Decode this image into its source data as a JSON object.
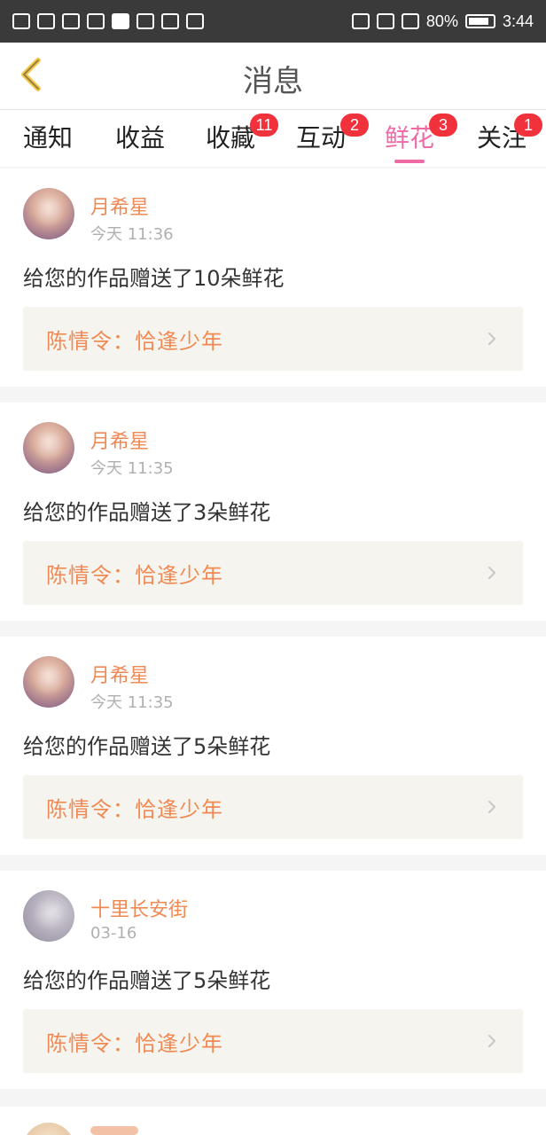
{
  "status_bar": {
    "battery_text": "80%",
    "time": "3:44"
  },
  "header": {
    "title": "消息",
    "back_icon": "chevron-left-icon"
  },
  "tabs": [
    {
      "label": "通知",
      "badge": ""
    },
    {
      "label": "收益",
      "badge": ""
    },
    {
      "label": "收藏",
      "badge": "11"
    },
    {
      "label": "互动",
      "badge": "2"
    },
    {
      "label": "鲜花",
      "badge": "3",
      "active": true
    },
    {
      "label": "关注",
      "badge": "1"
    }
  ],
  "feed": {
    "items": [
      {
        "name": "月希星",
        "time": "今天 11:36",
        "message": "给您的作品赠送了10朵鲜花",
        "work": "陈情令：恰逢少年"
      },
      {
        "name": "月希星",
        "time": "今天 11:35",
        "message": "给您的作品赠送了3朵鲜花",
        "work": "陈情令：恰逢少年"
      },
      {
        "name": "月希星",
        "time": "今天 11:35",
        "message": "给您的作品赠送了5朵鲜花",
        "work": "陈情令：恰逢少年"
      },
      {
        "name": "十里长安街",
        "time": "03-16",
        "message": "给您的作品赠送了5朵鲜花",
        "work": "陈情令：恰逢少年"
      }
    ]
  },
  "colors": {
    "accent": "#f06aa6",
    "name": "#f08a55",
    "badge": "#f1313b",
    "work_bg": "#f6f4ee"
  }
}
